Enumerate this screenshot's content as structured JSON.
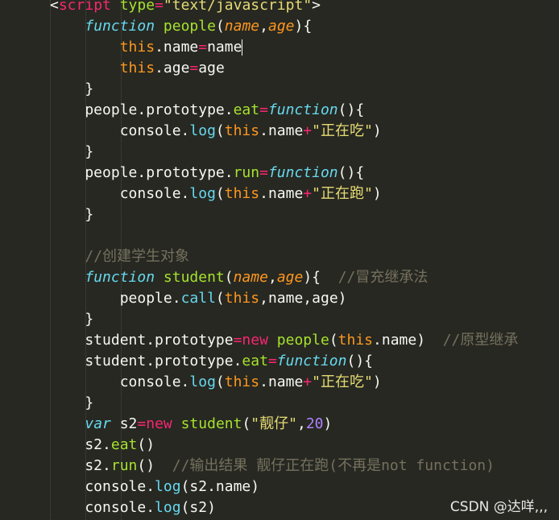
{
  "colors": {
    "background": "#272822",
    "current_line": "#3e3d32",
    "plain": "#f8f8f2",
    "keyword": "#f92672",
    "storage": "#66d9ef",
    "function_name": "#a6e22e",
    "parameter": "#fd971f",
    "string": "#e6db74",
    "number": "#ae81ff",
    "comment": "#75715e"
  },
  "editor": {
    "active_line": 2,
    "lines": [
      [
        [
          "<",
          "plain"
        ],
        [
          "script",
          "keyword"
        ],
        [
          " ",
          "plain"
        ],
        [
          "type",
          "function_name"
        ],
        [
          "=",
          "keyword"
        ],
        [
          "\"text/javascript\"",
          "string"
        ],
        [
          ">",
          "plain"
        ]
      ],
      [
        [
          "    ",
          "plain"
        ],
        [
          "function",
          "storage_i"
        ],
        [
          " ",
          "plain"
        ],
        [
          "people",
          "function_name"
        ],
        [
          "(",
          "plain"
        ],
        [
          "name",
          "parameter_i"
        ],
        [
          ",",
          "plain"
        ],
        [
          "age",
          "parameter_i"
        ],
        [
          "){",
          "plain"
        ]
      ],
      [
        [
          "        ",
          "plain"
        ],
        [
          "this",
          "parameter"
        ],
        [
          ".name",
          "plain"
        ],
        [
          "=",
          "keyword"
        ],
        [
          "name",
          "plain"
        ]
      ],
      [
        [
          "        ",
          "plain"
        ],
        [
          "this",
          "parameter"
        ],
        [
          ".age",
          "plain"
        ],
        [
          "=",
          "keyword"
        ],
        [
          "age",
          "plain"
        ]
      ],
      [
        [
          "    }",
          "plain"
        ]
      ],
      [
        [
          "    people.prototype.",
          "plain"
        ],
        [
          "eat",
          "function_name"
        ],
        [
          "=",
          "keyword"
        ],
        [
          "function",
          "storage_i"
        ],
        [
          "(){",
          "plain"
        ]
      ],
      [
        [
          "        console.",
          "plain"
        ],
        [
          "log",
          "storage"
        ],
        [
          "(",
          "plain"
        ],
        [
          "this",
          "parameter"
        ],
        [
          ".name",
          "plain"
        ],
        [
          "+",
          "keyword"
        ],
        [
          "\"正在吃\"",
          "string"
        ],
        [
          ")",
          "plain"
        ]
      ],
      [
        [
          "    }",
          "plain"
        ]
      ],
      [
        [
          "    people.prototype.",
          "plain"
        ],
        [
          "run",
          "function_name"
        ],
        [
          "=",
          "keyword"
        ],
        [
          "function",
          "storage_i"
        ],
        [
          "(){",
          "plain"
        ]
      ],
      [
        [
          "        console.",
          "plain"
        ],
        [
          "log",
          "storage"
        ],
        [
          "(",
          "plain"
        ],
        [
          "this",
          "parameter"
        ],
        [
          ".name",
          "plain"
        ],
        [
          "+",
          "keyword"
        ],
        [
          "\"正在跑\"",
          "string"
        ],
        [
          ")",
          "plain"
        ]
      ],
      [
        [
          "    }",
          "plain"
        ]
      ],
      [
        [
          "",
          "plain"
        ]
      ],
      [
        [
          "    ",
          "plain"
        ],
        [
          "//创建学生对象",
          "comment"
        ]
      ],
      [
        [
          "    ",
          "plain"
        ],
        [
          "function",
          "storage_i"
        ],
        [
          " ",
          "plain"
        ],
        [
          "student",
          "function_name"
        ],
        [
          "(",
          "plain"
        ],
        [
          "name",
          "parameter_i"
        ],
        [
          ",",
          "plain"
        ],
        [
          "age",
          "parameter_i"
        ],
        [
          "){  ",
          "plain"
        ],
        [
          "//冒充继承法",
          "comment"
        ]
      ],
      [
        [
          "        people.",
          "plain"
        ],
        [
          "call",
          "storage"
        ],
        [
          "(",
          "plain"
        ],
        [
          "this",
          "parameter"
        ],
        [
          ",name,age)",
          "plain"
        ]
      ],
      [
        [
          "    }",
          "plain"
        ]
      ],
      [
        [
          "    student.prototype",
          "plain"
        ],
        [
          "=",
          "keyword"
        ],
        [
          "new",
          "keyword"
        ],
        [
          " ",
          "plain"
        ],
        [
          "people",
          "function_name"
        ],
        [
          "(",
          "plain"
        ],
        [
          "this",
          "parameter"
        ],
        [
          ".name)  ",
          "plain"
        ],
        [
          "//原型继承",
          "comment"
        ]
      ],
      [
        [
          "    student.prototype.",
          "plain"
        ],
        [
          "eat",
          "function_name"
        ],
        [
          "=",
          "keyword"
        ],
        [
          "function",
          "storage_i"
        ],
        [
          "(){",
          "plain"
        ]
      ],
      [
        [
          "        console.",
          "plain"
        ],
        [
          "log",
          "storage"
        ],
        [
          "(",
          "plain"
        ],
        [
          "this",
          "parameter"
        ],
        [
          ".name",
          "plain"
        ],
        [
          "+",
          "keyword"
        ],
        [
          "\"正在吃\"",
          "string"
        ],
        [
          ")",
          "plain"
        ]
      ],
      [
        [
          "    }",
          "plain"
        ]
      ],
      [
        [
          "    ",
          "plain"
        ],
        [
          "var",
          "storage_i"
        ],
        [
          " s2",
          "plain"
        ],
        [
          "=",
          "keyword"
        ],
        [
          "new",
          "keyword"
        ],
        [
          " ",
          "plain"
        ],
        [
          "student",
          "function_name"
        ],
        [
          "(",
          "plain"
        ],
        [
          "\"靓仔\"",
          "string"
        ],
        [
          ",",
          "plain"
        ],
        [
          "20",
          "number"
        ],
        [
          ")",
          "plain"
        ]
      ],
      [
        [
          "    s2.",
          "plain"
        ],
        [
          "eat",
          "function_name"
        ],
        [
          "()",
          "plain"
        ]
      ],
      [
        [
          "    s2.",
          "plain"
        ],
        [
          "run",
          "function_name"
        ],
        [
          "()  ",
          "plain"
        ],
        [
          "//输出结果 靓仔正在跑(不再是not function)",
          "comment"
        ]
      ],
      [
        [
          "    console.",
          "plain"
        ],
        [
          "log",
          "storage"
        ],
        [
          "(s2.name)",
          "plain"
        ]
      ],
      [
        [
          "    console.",
          "plain"
        ],
        [
          "log",
          "storage"
        ],
        [
          "(s2)",
          "plain"
        ]
      ]
    ]
  },
  "watermark": "CSDN @达咩,,,"
}
